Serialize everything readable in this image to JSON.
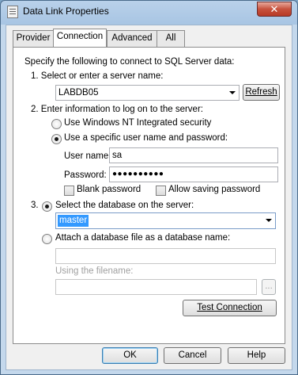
{
  "window": {
    "title": "Data Link Properties",
    "close_symbol": "✕"
  },
  "tabs": [
    "Provider",
    "Connection",
    "Advanced",
    "All"
  ],
  "active_tab": "Connection",
  "connection": {
    "intro": "Specify the following to connect to SQL Server data:",
    "step1_label": "1. Select or enter a server name:",
    "server_name": "LABDB05",
    "refresh_label": "Refresh",
    "step2_label": "2. Enter information to log on to the server:",
    "radio_nt": "Use Windows NT Integrated security",
    "radio_specific": "Use a specific user name and password:",
    "user_name_label": "User name:",
    "user_name_value": "sa",
    "password_label": "Password:",
    "password_value": "●●●●●●●●●●",
    "blank_password_label": "Blank password",
    "allow_saving_label": "Allow saving password",
    "step3_prefix": "3.",
    "radio_select_db": "Select the database on the server:",
    "database_value": "master",
    "radio_attach": "Attach a database file as a database name:",
    "attach_name_value": "",
    "using_filename_label": "Using the filename:",
    "filename_value": "",
    "browse_label": "...",
    "test_connection_label": "Test Connection"
  },
  "footer": {
    "ok_label": "OK",
    "cancel_label": "Cancel",
    "help_label": "Help"
  }
}
